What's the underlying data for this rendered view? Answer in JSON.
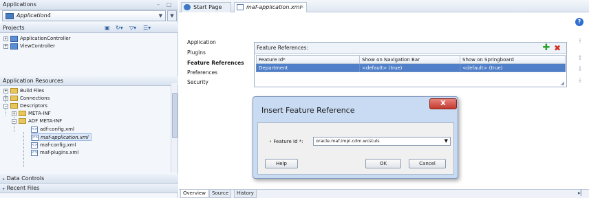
{
  "left_panel": {
    "applications_title": "Applications",
    "app_selector": "Application4",
    "projects_title": "Projects",
    "projects": [
      "ApplicationController",
      "ViewController"
    ],
    "app_resources_title": "Application Resources",
    "resources": {
      "build_files": "Build Files",
      "connections": "Connections",
      "descriptors": "Descriptors",
      "meta_inf": "META-INF",
      "adf_meta_inf": "ADF META-INF",
      "files": [
        "adf-config.xml",
        "maf-application.xml",
        "maf-config.xml",
        "maf-plugins.xml"
      ]
    },
    "data_controls": "Data Controls",
    "recent_files": "Recent Files"
  },
  "tabs": [
    {
      "label": "Start Page",
      "icon": "globe-icon"
    },
    {
      "label": "maf-application.xml",
      "icon": "xml-file-icon"
    }
  ],
  "nav": [
    "Application",
    "Plugins",
    "Feature References",
    "Preferences",
    "Security"
  ],
  "nav_active": "Feature References",
  "feature_refs": {
    "title": "Feature References:",
    "columns": [
      "Feature Id*",
      "Show on Navigation Bar",
      "Show on Springboard"
    ],
    "rows": [
      [
        "Department",
        "<default> (true)",
        "<default> (true)"
      ]
    ]
  },
  "bottom_tabs": [
    "Overview",
    "Source",
    "History"
  ],
  "dialog": {
    "title": "Insert Feature Reference",
    "close": "X",
    "feature_id_label": "Feature Id *:",
    "feature_id_value": "oracle.maf.impl.cdm.wcstuls",
    "help": "Help",
    "ok": "OK",
    "cancel": "Cancel"
  },
  "colors": {
    "selected_row": "#4f7fc9",
    "dialog_bg": "#c9dbf3",
    "close_red": "#c33a2e"
  }
}
